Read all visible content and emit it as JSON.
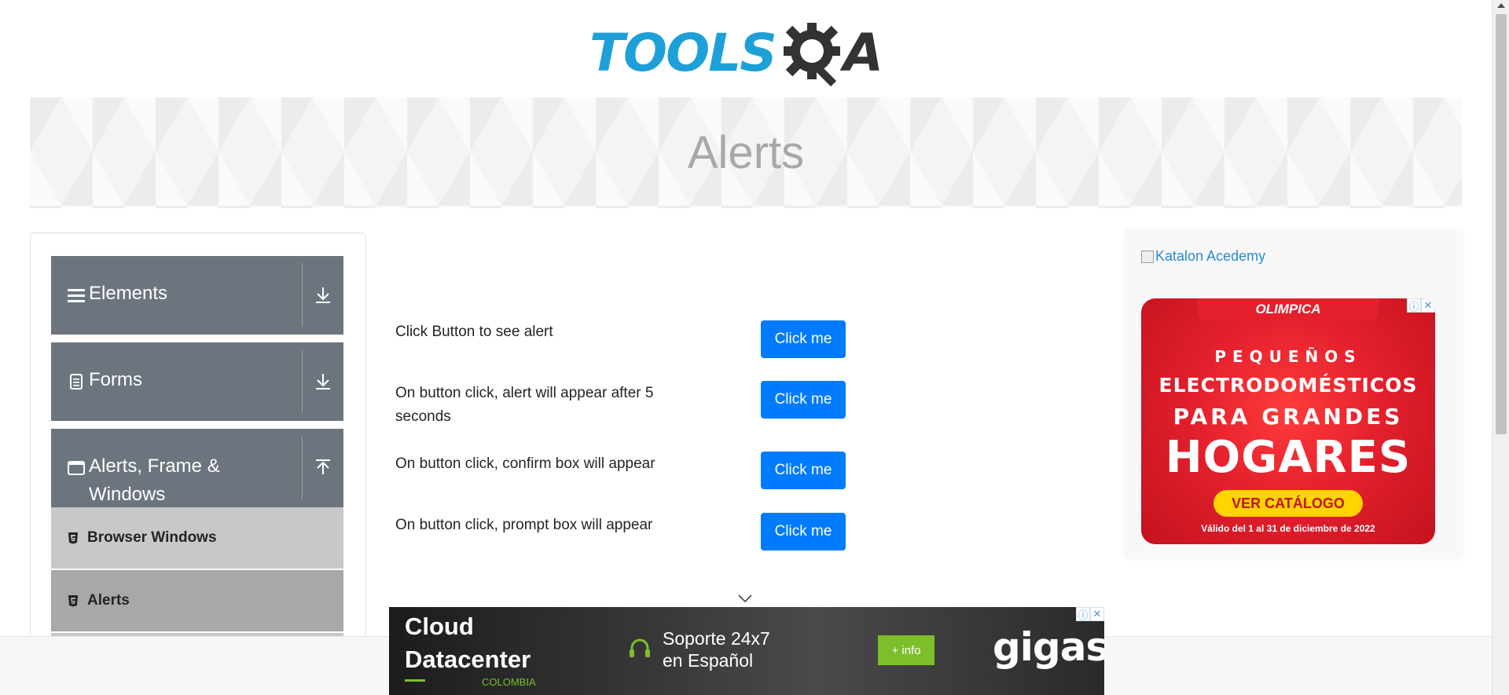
{
  "header": {
    "logo_tools": "TOOLS",
    "logo_a": "A"
  },
  "banner": {
    "title": "Alerts"
  },
  "sidebar": {
    "groups": [
      {
        "label": "Elements",
        "icon": "menu-icon",
        "toggle": "download-icon"
      },
      {
        "label": "Forms",
        "icon": "document-icon",
        "toggle": "download-icon"
      },
      {
        "label": "Alerts, Frame & Windows",
        "icon": "window-icon",
        "toggle": "upload-icon"
      }
    ],
    "items": [
      {
        "label": "Browser Windows",
        "icon": "html5-icon"
      },
      {
        "label": "Alerts",
        "icon": "html5-icon"
      }
    ]
  },
  "main": {
    "rows": [
      {
        "label": "Click Button to see alert",
        "button": "Click me"
      },
      {
        "label": "On button click, alert will appear after 5 seconds",
        "button": "Click me"
      },
      {
        "label": "On button click, confirm box will appear",
        "button": "Click me"
      },
      {
        "label": "On button click, prompt box will appear",
        "button": "Click me"
      }
    ]
  },
  "right_ad": {
    "link_text": "Katalon Acedemy",
    "brand": "OLIMPICA",
    "line1": "PEQUEÑOS",
    "line2": "ELECTRODOMÉSTICOS",
    "line3": "PARA GRANDES",
    "line4": "HOGARES",
    "cta": "VER CATÁLOGO",
    "footnote": "Válido del 1 al 31 de diciembre de 2022"
  },
  "bottom_ad": {
    "title_line1": "Cloud",
    "title_line2": "Datacenter",
    "country": "COLOMBIA",
    "support_line1": "Soporte 24x7",
    "support_line2": "en Español",
    "button": "+ info",
    "brand": "gigas"
  },
  "colors": {
    "brand_blue": "#1da0d8",
    "sidebar_header": "#6c757d",
    "button_primary": "#007bff",
    "ad_red": "#e4202d",
    "ad_green": "#7cbf2a"
  }
}
